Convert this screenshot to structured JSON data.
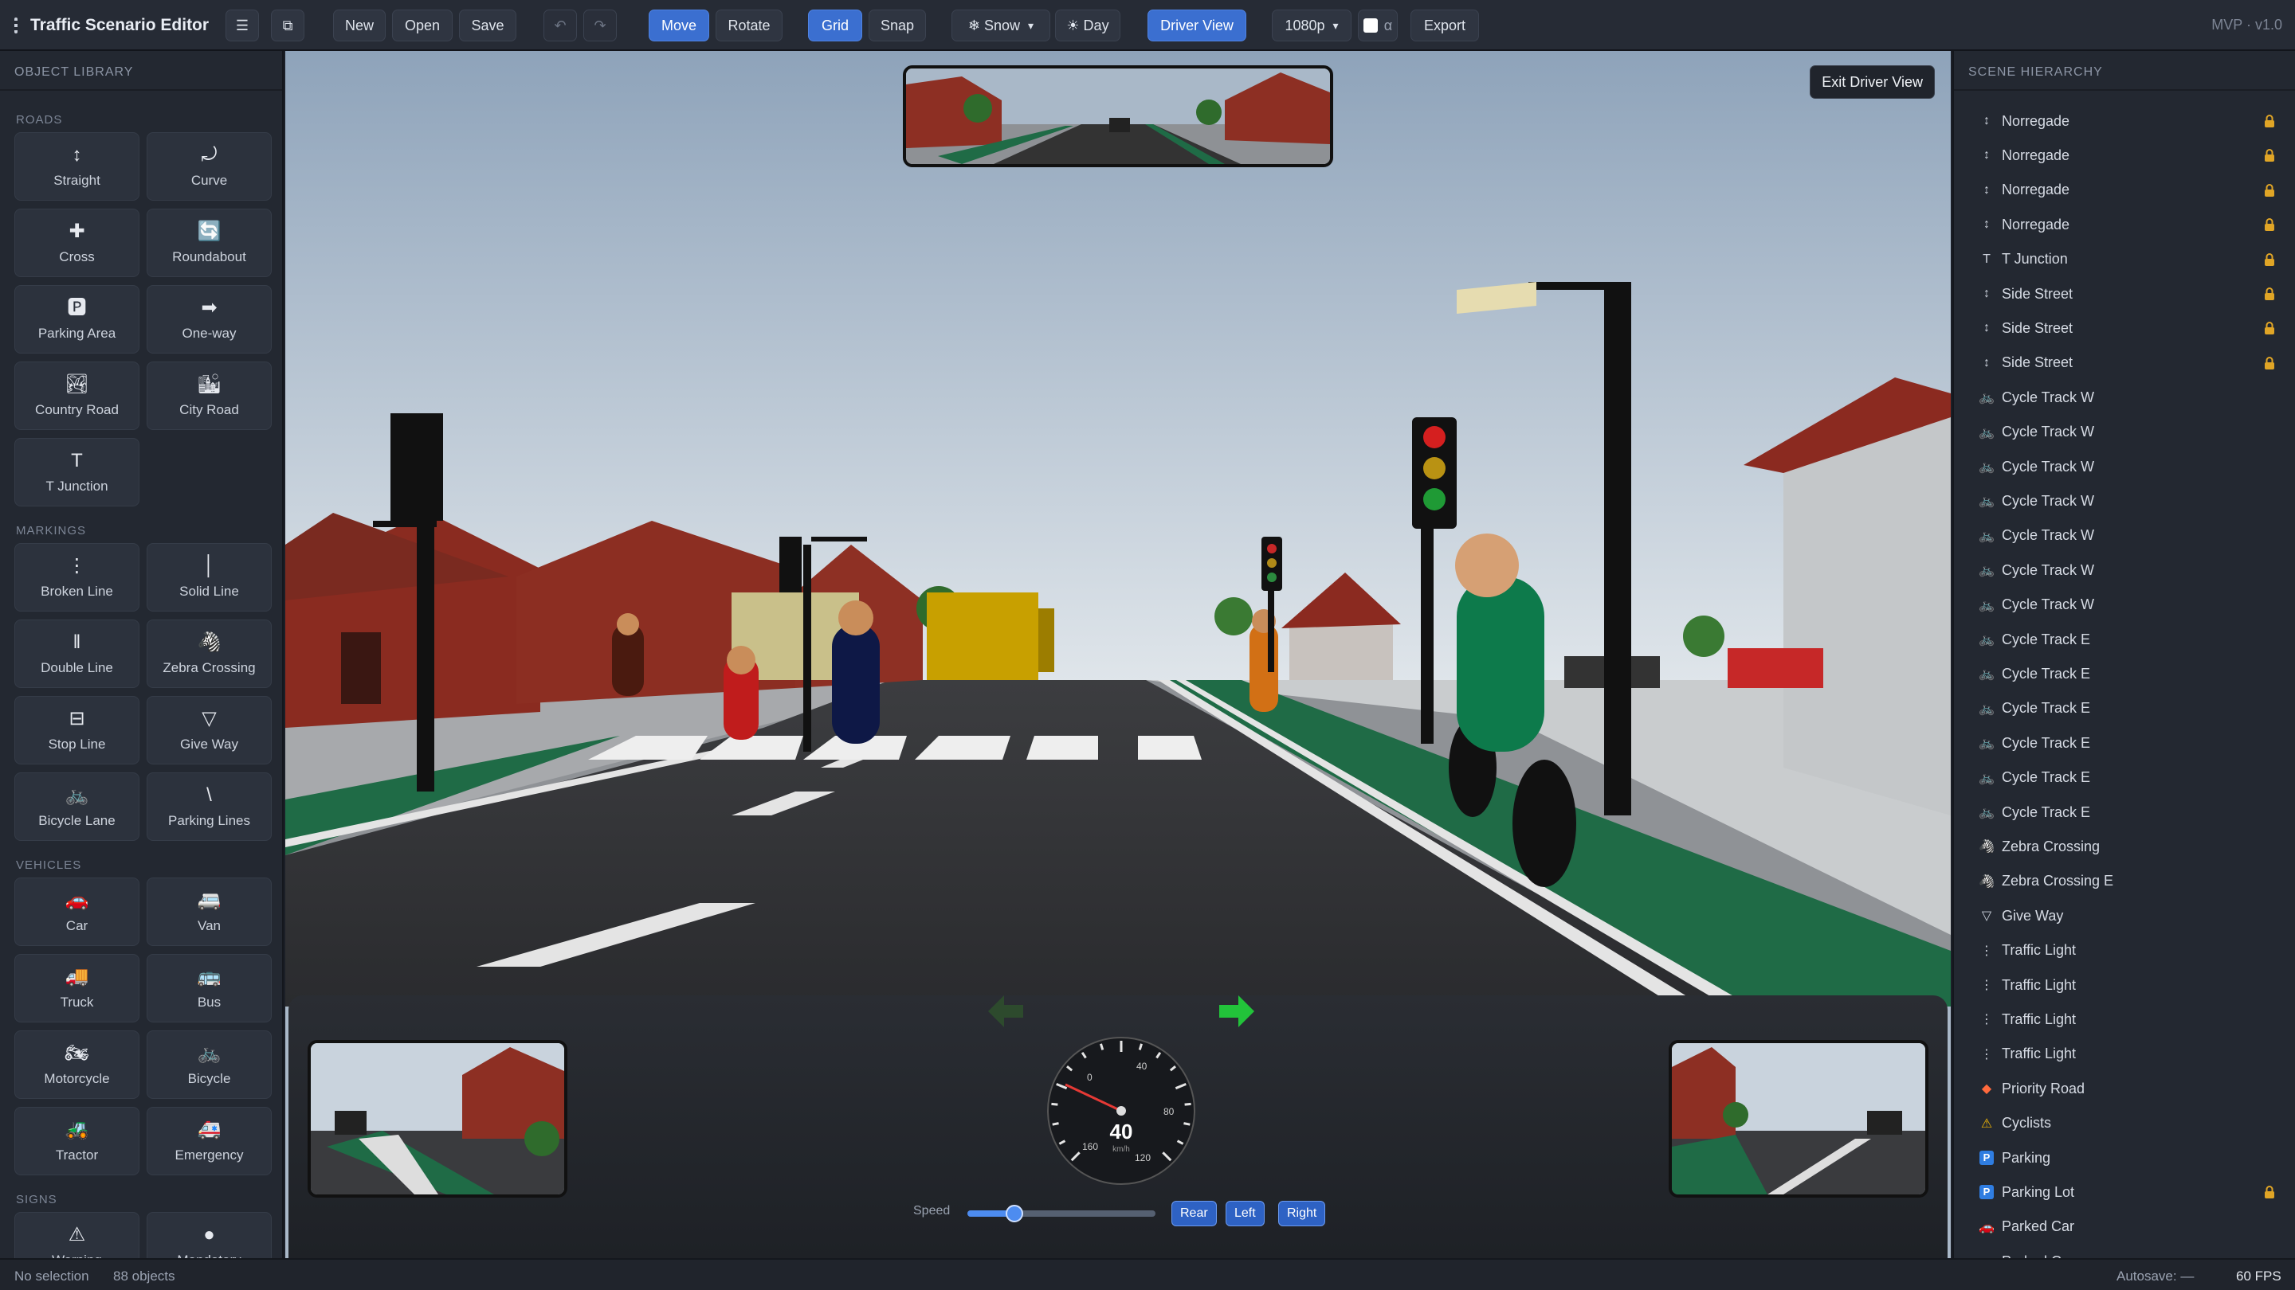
{
  "app": {
    "title": "Traffic Scenario Editor",
    "version": "MVP · v1.0"
  },
  "toolbar": {
    "new": "New",
    "open": "Open",
    "save": "Save",
    "undo": "↶",
    "redo": "↷",
    "move": "Move",
    "rotate": "Rotate",
    "grid": "Grid",
    "snap": "Snap",
    "weather": "❄ Snow",
    "time": "☀ Day",
    "driver_view": "Driver View",
    "resolution": "1080p",
    "alpha": "α",
    "export": "Export"
  },
  "library": {
    "title": "OBJECT LIBRARY",
    "categories": [
      "ROADS",
      "MARKINGS",
      "VEHICLES",
      "SIGNS"
    ],
    "tiles": [
      {
        "label": "Straight",
        "icon": "↕"
      },
      {
        "label": "Curve",
        "icon": "⤾"
      },
      {
        "label": "Cross",
        "icon": "✚"
      },
      {
        "label": "Roundabout",
        "icon": "🔄"
      },
      {
        "label": "Parking Area",
        "icon": "🅿"
      },
      {
        "label": "One-way",
        "icon": "➡"
      },
      {
        "label": "Country Road",
        "icon": "🏞"
      },
      {
        "label": "City Road",
        "icon": "🏙"
      },
      {
        "label": "T Junction",
        "icon": "T"
      },
      {
        "label": "Broken Line",
        "icon": "⋮"
      },
      {
        "label": "Solid Line",
        "icon": "│"
      },
      {
        "label": "Double Line",
        "icon": "‖"
      },
      {
        "label": "Zebra Crossing",
        "icon": "🦓"
      },
      {
        "label": "Stop Line",
        "icon": "⊟"
      },
      {
        "label": "Give Way",
        "icon": "▽"
      },
      {
        "label": "Bicycle Lane",
        "icon": "🚲"
      },
      {
        "label": "Parking Lines",
        "icon": "\\"
      },
      {
        "label": "Car",
        "icon": "🚗"
      },
      {
        "label": "Van",
        "icon": "🚐"
      },
      {
        "label": "Truck",
        "icon": "🚚"
      },
      {
        "label": "Bus",
        "icon": "🚌"
      },
      {
        "label": "Motorcycle",
        "icon": "🏍"
      },
      {
        "label": "Bicycle",
        "icon": "🚲"
      },
      {
        "label": "Tractor",
        "icon": "🚜"
      },
      {
        "label": "Emergency",
        "icon": "🚑"
      },
      {
        "label": "Warning",
        "icon": "⚠"
      },
      {
        "label": "Mandatory",
        "icon": "●"
      }
    ]
  },
  "viewport": {
    "exit_driver_view": "Exit Driver View",
    "speed_label": "Speed",
    "speed_value": "40",
    "speed_unit": "km/h",
    "speed_fraction": 0.25,
    "gauge_ticks": [
      "0",
      "40",
      "80",
      "120",
      "160"
    ],
    "camera_buttons": {
      "rear": "Rear",
      "left": "Left",
      "right": "Right"
    },
    "sky_color": "#a9b8c8",
    "grass_color": "#1f6b46"
  },
  "hierarchy": {
    "title": "SCENE HIERARCHY",
    "items": [
      {
        "label": "Norregade",
        "icon": "↕",
        "locked": true
      },
      {
        "label": "Norregade",
        "icon": "↕",
        "locked": true
      },
      {
        "label": "Norregade",
        "icon": "↕",
        "locked": true
      },
      {
        "label": "Norregade",
        "icon": "↕",
        "locked": true
      },
      {
        "label": "T Junction",
        "icon": "T",
        "locked": true
      },
      {
        "label": "Side Street",
        "icon": "↕",
        "locked": true
      },
      {
        "label": "Side Street",
        "icon": "↕",
        "locked": true
      },
      {
        "label": "Side Street",
        "icon": "↕",
        "locked": true
      },
      {
        "label": "Cycle Track W",
        "icon": "🚲",
        "locked": false
      },
      {
        "label": "Cycle Track W",
        "icon": "🚲",
        "locked": false
      },
      {
        "label": "Cycle Track W",
        "icon": "🚲",
        "locked": false
      },
      {
        "label": "Cycle Track W",
        "icon": "🚲",
        "locked": false
      },
      {
        "label": "Cycle Track W",
        "icon": "🚲",
        "locked": false
      },
      {
        "label": "Cycle Track W",
        "icon": "🚲",
        "locked": false
      },
      {
        "label": "Cycle Track W",
        "icon": "🚲",
        "locked": false
      },
      {
        "label": "Cycle Track E",
        "icon": "🚲",
        "locked": false
      },
      {
        "label": "Cycle Track E",
        "icon": "🚲",
        "locked": false
      },
      {
        "label": "Cycle Track E",
        "icon": "🚲",
        "locked": false
      },
      {
        "label": "Cycle Track E",
        "icon": "🚲",
        "locked": false
      },
      {
        "label": "Cycle Track E",
        "icon": "🚲",
        "locked": false
      },
      {
        "label": "Cycle Track E",
        "icon": "🚲",
        "locked": false
      },
      {
        "label": "Zebra Crossing",
        "icon": "🦓",
        "locked": false
      },
      {
        "label": "Zebra Crossing E",
        "icon": "🦓",
        "locked": false
      },
      {
        "label": "Give Way",
        "icon": "▽",
        "locked": false
      },
      {
        "label": "Traffic Light",
        "icon": "⋮",
        "locked": false
      },
      {
        "label": "Traffic Light",
        "icon": "⋮",
        "locked": false
      },
      {
        "label": "Traffic Light",
        "icon": "⋮",
        "locked": false
      },
      {
        "label": "Traffic Light",
        "icon": "⋮",
        "locked": false
      },
      {
        "label": "Priority Road",
        "icon": "◆",
        "locked": false
      },
      {
        "label": "Cyclists",
        "icon": "⚠",
        "locked": false
      },
      {
        "label": "Parking",
        "icon": "P",
        "locked": false
      },
      {
        "label": "Parking Lot",
        "icon": "P",
        "locked": true
      },
      {
        "label": "Parked Car",
        "icon": "🚗",
        "locked": false
      },
      {
        "label": "Parked Car",
        "icon": "🚗",
        "locked": false
      }
    ]
  },
  "status": {
    "selection": "No selection",
    "objects": "88 objects",
    "autosave": "Autosave: —",
    "fps": "60 FPS"
  }
}
